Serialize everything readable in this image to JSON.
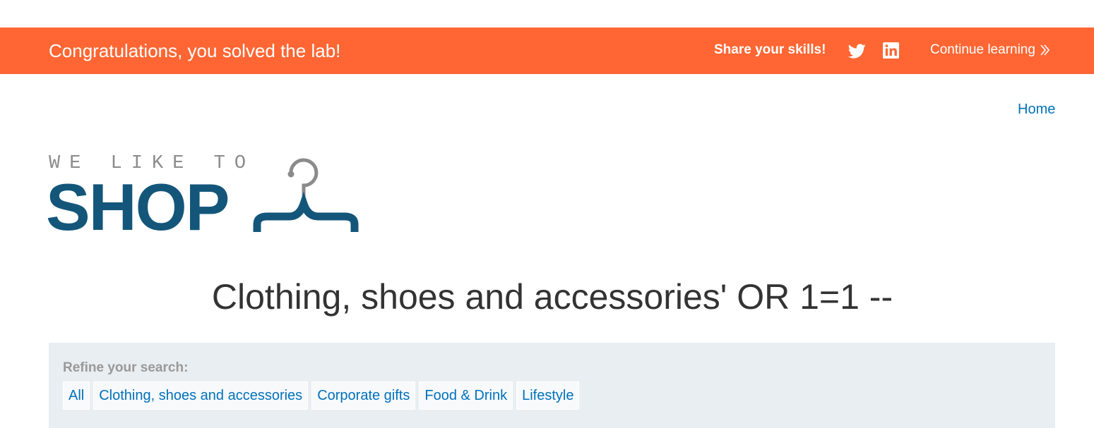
{
  "banner": {
    "message": "Congratulations, you solved the lab!",
    "share_label": "Share your skills!",
    "share_icons": [
      "twitter-icon",
      "linkedin-icon"
    ],
    "continue_label": "Continue learning",
    "background_color": "#ff6633"
  },
  "nav": {
    "home_label": "Home"
  },
  "logo": {
    "top_text": "WE LIKE TO",
    "main_text": "SHOP",
    "icon": "hanger-icon",
    "main_color": "#14567a"
  },
  "page": {
    "title": "Clothing, shoes and accessories' OR 1=1 --"
  },
  "filters": {
    "label": "Refine your search:",
    "items": [
      "All",
      "Clothing, shoes and accessories",
      "Corporate gifts",
      "Food & Drink",
      "Lifestyle"
    ]
  },
  "colors": {
    "link": "#0071bc",
    "panel_bg": "#e8eef1"
  }
}
